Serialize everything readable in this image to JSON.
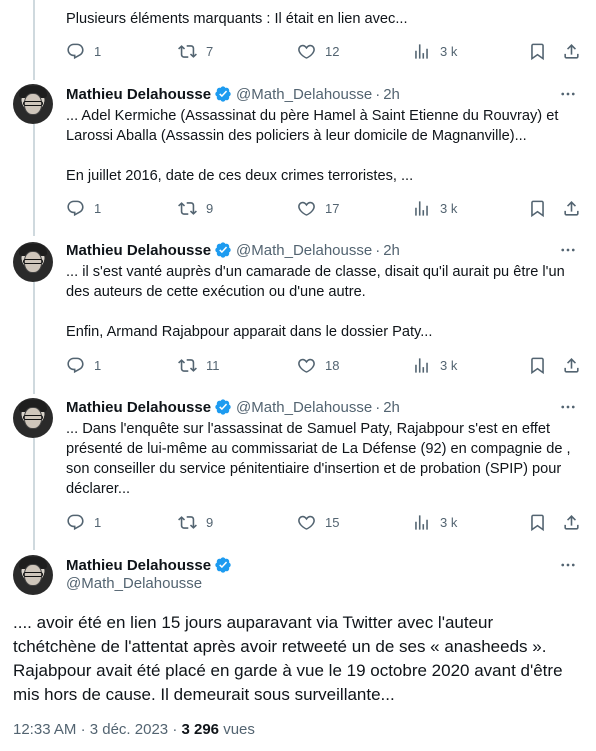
{
  "colors": {
    "verified": "#1d9bf0",
    "muted": "#536471",
    "text": "#0f1419",
    "line": "#cfd9de"
  },
  "tweet0": {
    "text": "Plusieurs éléments marquants : Il était en lien avec...",
    "reply_count": "1",
    "retweet_count": "7",
    "like_count": "12",
    "view_count": "3 k"
  },
  "tweet1": {
    "name": "Mathieu Delahousse",
    "handle": "@Math_Delahousse",
    "dot": "·",
    "time": "2h",
    "text": "... Adel Kermiche (Assassinat du père Hamel à Saint Etienne du Rouvray) et Larossi Aballa (Assassin des policiers à leur domicile de Magnanville)...\n\nEn juillet 2016, date de ces deux crimes terroristes, ...",
    "reply_count": "1",
    "retweet_count": "9",
    "like_count": "17",
    "view_count": "3 k"
  },
  "tweet2": {
    "name": "Mathieu Delahousse",
    "handle": "@Math_Delahousse",
    "dot": "·",
    "time": "2h",
    "text": "... il s'est vanté auprès d'un camarade de classe, disait qu'il aurait pu être l'un des auteurs de cette exécution ou d'une autre.\n\nEnfin, Armand Rajabpour apparait dans le dossier Paty...",
    "reply_count": "1",
    "retweet_count": "11",
    "like_count": "18",
    "view_count": "3 k"
  },
  "tweet3": {
    "name": "Mathieu Delahousse",
    "handle": "@Math_Delahousse",
    "dot": "·",
    "time": "2h",
    "text": "... Dans l'enquête sur l'assassinat de Samuel Paty, Rajabpour s'est en effet présenté de lui-même au commissariat de La Défense (92) en compagnie de , son conseiller du service pénitentiaire d'insertion et de probation (SPIP) pour déclarer...",
    "reply_count": "1",
    "retweet_count": "9",
    "like_count": "15",
    "view_count": "3 k"
  },
  "main": {
    "name": "Mathieu Delahousse",
    "handle": "@Math_Delahousse",
    "text": ".... avoir été en lien 15 jours auparavant via Twitter avec l'auteur tchétchène de l'attentat après avoir retweeté un de ses « anasheeds ». Rajabpour avait été placé en garde à vue le 19 octobre 2020 avant d'être mis hors de cause. Il demeurait sous surveillante...",
    "time": "12:33 AM",
    "sep": "·",
    "date": "3 déc. 2023",
    "views_count": "3 296",
    "views_label": "vues"
  },
  "icons": [
    "reply-icon",
    "retweet-icon",
    "like-icon",
    "views-icon",
    "bookmark-icon",
    "share-icon",
    "verified-badge-icon",
    "more-icon"
  ]
}
